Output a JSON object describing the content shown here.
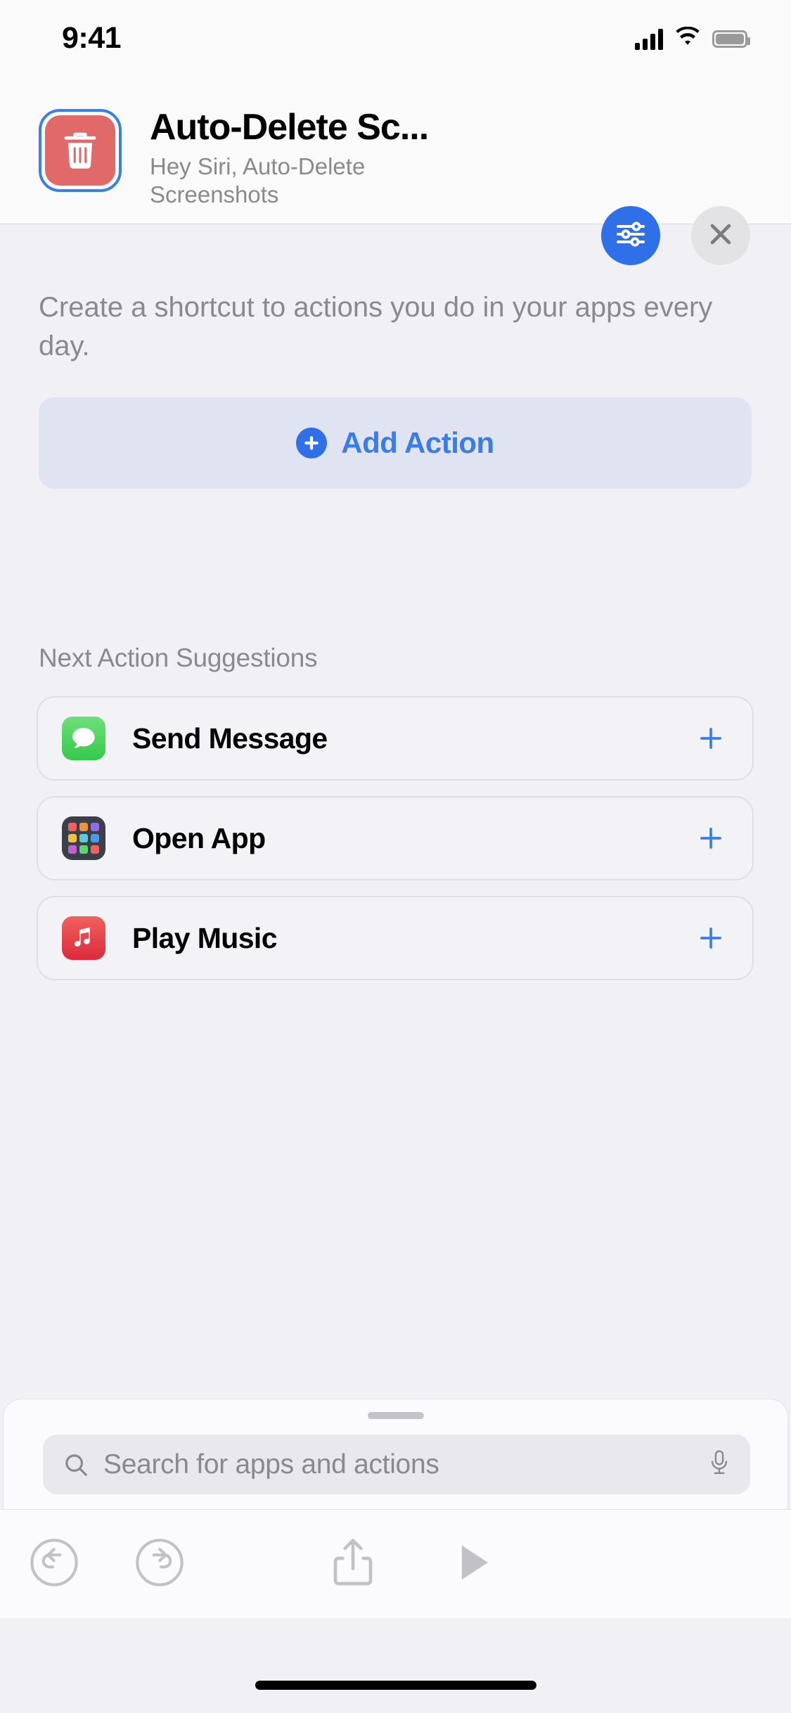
{
  "status_bar": {
    "time": "9:41",
    "cellular_icon": "cellular-signal-icon",
    "wifi_icon": "wifi-icon",
    "battery_icon": "battery-icon"
  },
  "header": {
    "shortcut_icon": "trash-icon",
    "shortcut_icon_color": "#e06a6a",
    "selection_border_color": "#3b7fe0",
    "title": "Auto-Delete Sc...",
    "subtitle": "Hey Siri, Auto-Delete Screenshots",
    "settings_button": {
      "icon": "sliders-icon",
      "color": "#2f6fe8"
    },
    "close_button": {
      "icon": "close-x-icon",
      "color": "#e3e3e6"
    }
  },
  "content": {
    "description": "Create a shortcut to actions you do in your apps every day.",
    "add_action": {
      "label": "Add Action",
      "icon": "plus-circle-icon",
      "accent_color": "#3b7de8",
      "background_color": "#e0e4f2"
    },
    "suggestions_title": "Next Action Suggestions",
    "suggestions": [
      {
        "label": "Send Message",
        "icon": "messages-app-icon",
        "icon_color": "#36c84b",
        "add_icon": "plus-icon"
      },
      {
        "label": "Open App",
        "icon": "open-app-grid-icon",
        "icon_color": "#3a3f4a",
        "add_icon": "plus-icon"
      },
      {
        "label": "Play Music",
        "icon": "music-app-icon",
        "icon_color": "#d92b3c",
        "add_icon": "plus-icon"
      }
    ]
  },
  "search_sheet": {
    "grabber": "sheet-grabber-handle",
    "search": {
      "value": "",
      "placeholder": "Search for apps and actions",
      "search_icon": "search-icon",
      "mic_icon": "microphone-icon"
    }
  },
  "toolbar": {
    "undo": "undo-icon",
    "redo": "redo-icon",
    "share": "share-icon",
    "play": "play-icon"
  },
  "home_indicator": "home-indicator"
}
